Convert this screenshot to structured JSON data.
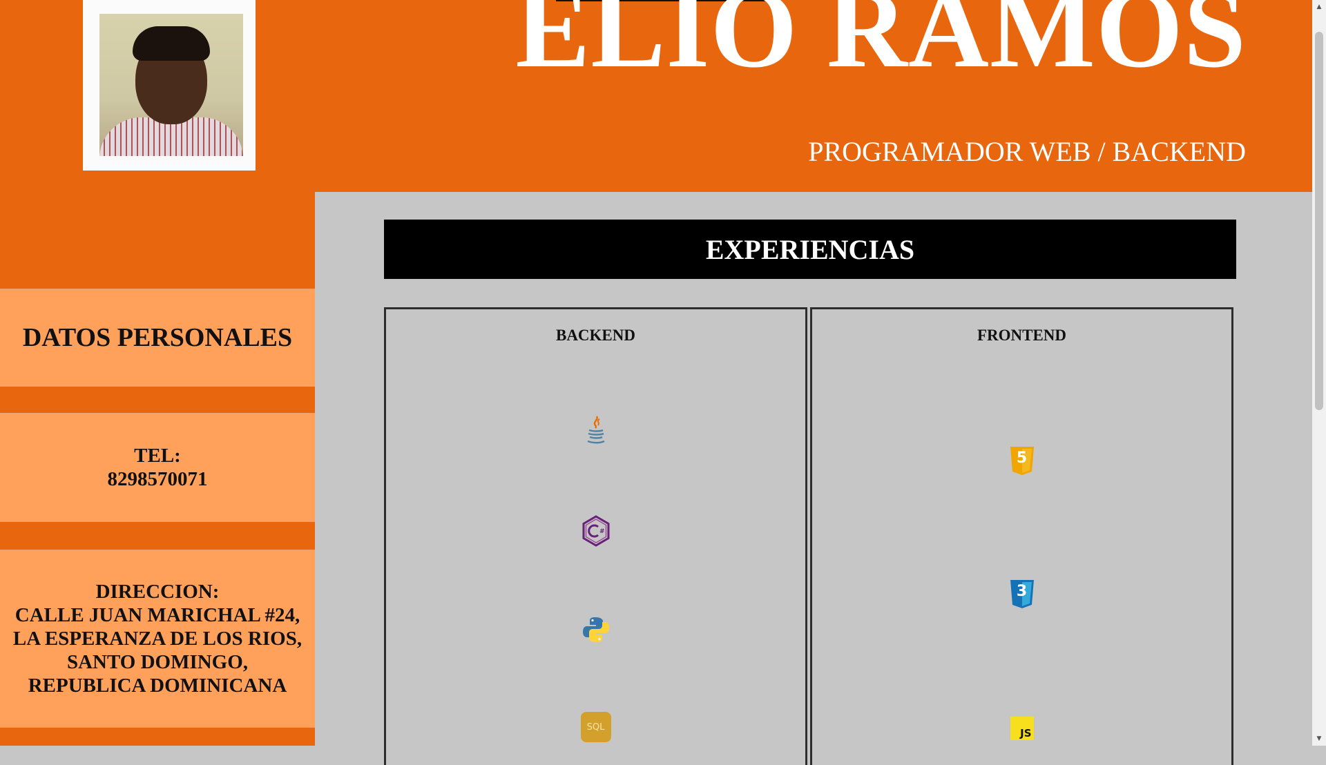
{
  "header": {
    "name": "ELIO RAMOS",
    "subtitle": "PROGRAMADOR WEB / BACKEND",
    "accent_color": "#e8670e"
  },
  "sidebar": {
    "section_title": "DATOS PERSONALES",
    "phone_label": "TEL:",
    "phone_value": "8298570071",
    "address_label": "DIRECCION:",
    "address_value": "CALLE JUAN MARICHAL #24, LA ESPERANZA DE LOS RIOS, SANTO DOMINGO, REPUBLICA DOMINICANA"
  },
  "experiences": {
    "title": "EXPERIENCIAS",
    "backend": {
      "title": "BACKEND",
      "icons": [
        {
          "name": "java-icon"
        },
        {
          "name": "csharp-icon"
        },
        {
          "name": "python-icon"
        },
        {
          "name": "sql-icon",
          "text": "SQL"
        }
      ]
    },
    "frontend": {
      "title": "FRONTEND",
      "icons": [
        {
          "name": "html5-icon",
          "text": "5"
        },
        {
          "name": "css3-icon",
          "text": "3"
        },
        {
          "name": "javascript-icon",
          "text": "JS"
        }
      ]
    }
  }
}
